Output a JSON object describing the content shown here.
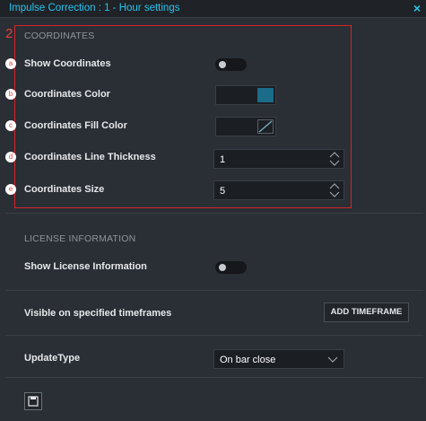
{
  "window": {
    "title": "Impulse Correction : 1 - Hour settings",
    "close_icon": "×"
  },
  "annotations": {
    "main": "2",
    "a": "a",
    "b": "b",
    "c": "c",
    "d": "d",
    "e": "e"
  },
  "coordinates": {
    "section_title": "COORDINATES",
    "show_label": "Show Coordinates",
    "show_enabled": false,
    "color_label": "Coordinates Color",
    "color_value": "#1a6c88",
    "fill_label": "Coordinates Fill Color",
    "thickness_label": "Coordinates Line Thickness",
    "thickness_value": "1",
    "size_label": "Coordinates Size",
    "size_value": "5"
  },
  "license": {
    "section_title": "LICENSE INFORMATION",
    "show_label": "Show License Information",
    "show_enabled": false
  },
  "timeframes": {
    "label": "Visible on specified timeframes",
    "button": "ADD TIMEFRAME"
  },
  "update": {
    "label": "UpdateType",
    "value": "On bar close"
  },
  "colors": {
    "accent": "#25c5f0",
    "annotation_red": "#d6252b"
  }
}
